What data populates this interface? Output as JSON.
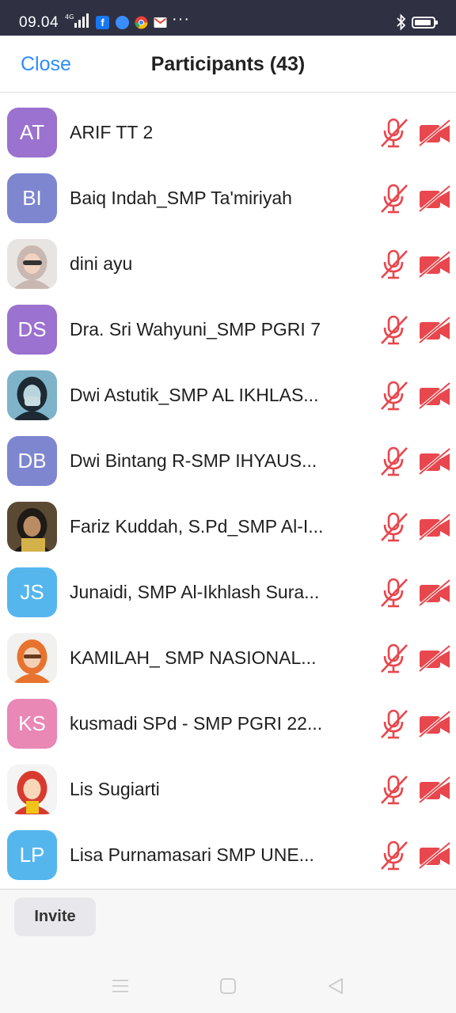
{
  "status_bar": {
    "time": "09.04",
    "network": "4G",
    "apps": [
      "facebook-icon",
      "messenger-icon",
      "chrome-icon",
      "gmail-icon"
    ],
    "more": "···"
  },
  "header": {
    "close_label": "Close",
    "title": "Participants (43)"
  },
  "participants": [
    {
      "name": "ARIF TT 2",
      "initials": "AT",
      "avatar_color": "#9b72cf"
    },
    {
      "name": "Baiq Indah_SMP Ta'miriyah",
      "initials": "BI",
      "avatar_color": "#7d86cf"
    },
    {
      "name": "dini ayu",
      "initials": "",
      "photo": "photo-hijab-grey"
    },
    {
      "name": "Dra. Sri Wahyuni_SMP PGRI 7",
      "initials": "DS",
      "avatar_color": "#9b72cf"
    },
    {
      "name": "Dwi Astutik_SMP AL IKHLAS...",
      "initials": "",
      "photo": "photo-hijab-dark"
    },
    {
      "name": "Dwi Bintang R-SMP IHYAUS...",
      "initials": "DB",
      "avatar_color": "#7d86cf"
    },
    {
      "name": "Fariz Kuddah, S.Pd_SMP Al-I...",
      "initials": "",
      "photo": "photo-man"
    },
    {
      "name": "Junaidi, SMP Al-Ikhlash Sura...",
      "initials": "JS",
      "avatar_color": "#55b6ee"
    },
    {
      "name": "KAMILAH_ SMP NASIONAL...",
      "initials": "",
      "photo": "photo-hijab-orange"
    },
    {
      "name": "kusmadi SPd - SMP PGRI 22...",
      "initials": "KS",
      "avatar_color": "#e987b5"
    },
    {
      "name": "Lis Sugiarti",
      "initials": "",
      "photo": "photo-cartoon"
    },
    {
      "name": "Lisa Purnamasari SMP UNE...",
      "initials": "LP",
      "avatar_color": "#55b6ee"
    }
  ],
  "status_icons": {
    "mic": "mic-muted-icon",
    "camera": "video-off-icon",
    "color": "#e8474d"
  },
  "footer": {
    "invite_label": "Invite"
  },
  "nav_bar": {
    "buttons": [
      "menu-icon",
      "home-icon",
      "back-icon"
    ]
  }
}
